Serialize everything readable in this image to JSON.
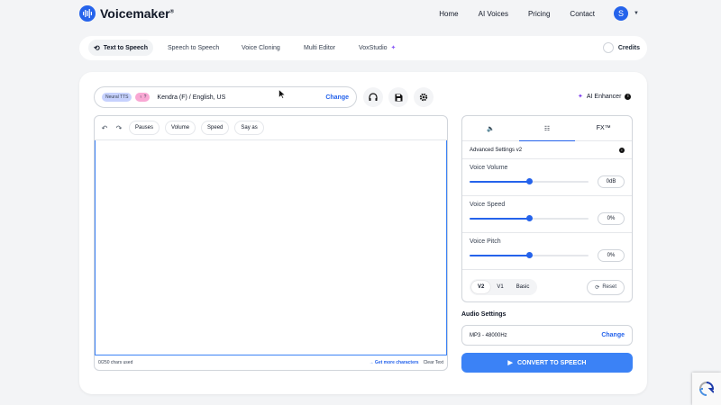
{
  "brand": {
    "name": "Voicemaker",
    "mark": "®"
  },
  "nav": {
    "items": [
      "Home",
      "AI Voices",
      "Pricing",
      "Contact"
    ],
    "avatar_letter": "S"
  },
  "tabs": [
    {
      "label": "Text to Speech",
      "active": true
    },
    {
      "label": "Speech to Speech",
      "active": false
    },
    {
      "label": "Voice Cloning",
      "active": false
    },
    {
      "label": "Multi Editor",
      "active": false
    },
    {
      "label": "VoxStudio",
      "active": false
    }
  ],
  "credits_label": "Credits",
  "voice": {
    "engine_badge": "Neural TTS",
    "gender_badge": "♀ ?",
    "name": "Kendra (F) / English, US",
    "change_label": "Change"
  },
  "ai_enhancer_label": "AI Enhancer",
  "editor": {
    "chips": [
      "Pauses",
      "Volume",
      "Speed",
      "Say as"
    ],
    "chars_used": "0/250 chars used",
    "more_chars": "→ Get more characters",
    "clear": "Clear Text"
  },
  "settings": {
    "tabs": [
      {
        "label": "🔈",
        "active": false
      },
      {
        "label": "☷",
        "active": true
      },
      {
        "label": "FX™",
        "active": false
      }
    ],
    "header": "Advanced Settings v2",
    "sliders": [
      {
        "label": "Voice Volume",
        "value": "0dB",
        "fraction": 0.5
      },
      {
        "label": "Voice Speed",
        "value": "0%",
        "fraction": 0.5
      },
      {
        "label": "Voice Pitch",
        "value": "0%",
        "fraction": 0.5
      }
    ],
    "versions": [
      {
        "label": "V2",
        "active": true
      },
      {
        "label": "V1",
        "active": false
      },
      {
        "label": "Basic",
        "active": false
      }
    ],
    "reset_label": "Reset"
  },
  "audio": {
    "title": "Audio Settings",
    "format": "MP3 - 48000Hz",
    "change_label": "Change"
  },
  "convert_label": "CONVERT TO SPEECH",
  "colors": {
    "accent": "#2563eb",
    "button": "#3b82f6"
  }
}
